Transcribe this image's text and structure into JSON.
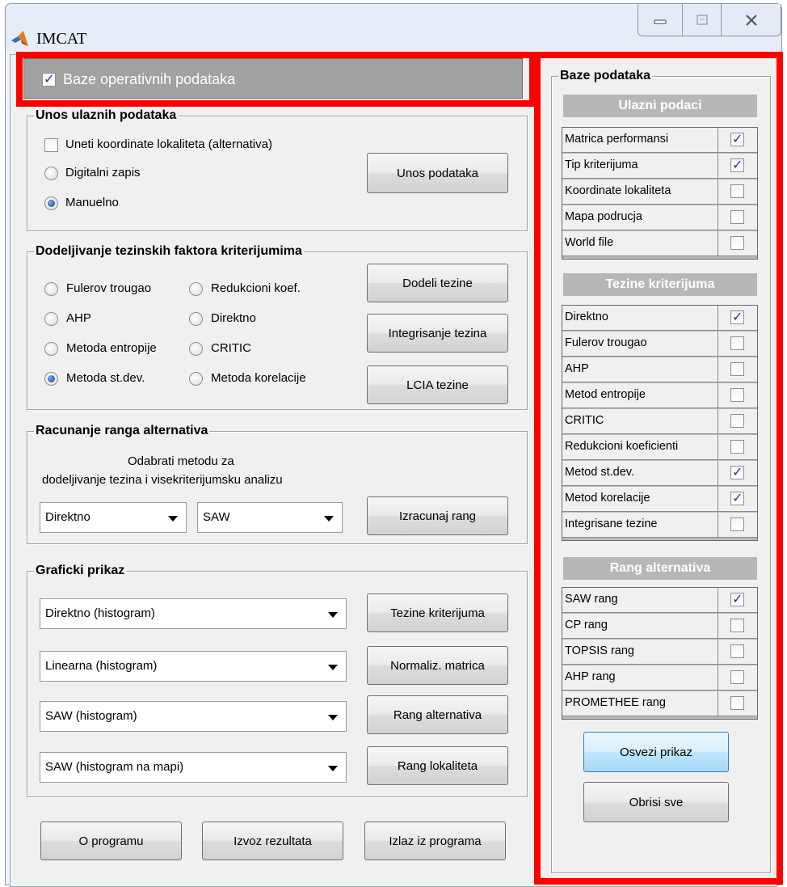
{
  "window": {
    "title": "IMCAT",
    "controls": [
      "minimize",
      "maximize",
      "close"
    ]
  },
  "top_checkbox": {
    "label": "Baze operativnih podataka",
    "checked": true
  },
  "unos": {
    "title": "Unos ulaznih podataka",
    "coords_label": "Uneti koordinate lokaliteta (alternativa)",
    "coords_checked": false,
    "digital_label": "Digitalni zapis",
    "manual_label": "Manuelno",
    "selected": "Manuelno",
    "button": "Unos podataka"
  },
  "dodeljivanje": {
    "title": "Dodeljivanje tezinskih faktora kriterijumima",
    "radios": [
      "Fulerov trougao",
      "Redukcioni koef.",
      "AHP",
      "Direktno",
      "Metoda entropije",
      "CRITIC",
      "Metoda st.dev.",
      "Metoda korelacije"
    ],
    "selected": "Metoda st.dev.",
    "buttons": [
      "Dodeli tezine",
      "Integrisanje tezina",
      "LCIA tezine"
    ]
  },
  "racunanje": {
    "title": "Racunanje ranga alternativa",
    "line1": "Odabrati metodu za",
    "line2": "dodeljivanje tezina i visekriterijumsku analizu",
    "select1": "Direktno",
    "select2": "SAW",
    "button": "Izracunaj rang"
  },
  "graficki": {
    "title": "Graficki prikaz",
    "rows": [
      {
        "select": "Direktno (histogram)",
        "button": "Tezine kriterijuma"
      },
      {
        "select": "Linearna (histogram)",
        "button": "Normaliz. matrica"
      },
      {
        "select": "SAW (histogram)",
        "button": "Rang alternativa"
      },
      {
        "select": "SAW (histogram na mapi)",
        "button": "Rang lokaliteta"
      }
    ]
  },
  "bottom_buttons": [
    "O programu",
    "Izvoz rezultata",
    "Izlaz iz programa"
  ],
  "baze": {
    "title": "Baze podataka",
    "sections": [
      {
        "header": "Ulazni podaci",
        "items": [
          {
            "label": "Matrica performansi",
            "checked": true
          },
          {
            "label": "Tip kriterijuma",
            "checked": true
          },
          {
            "label": "Koordinate lokaliteta",
            "checked": false
          },
          {
            "label": "Mapa podrucja",
            "checked": false
          },
          {
            "label": "World file",
            "checked": false
          }
        ]
      },
      {
        "header": "Tezine kriterijuma",
        "items": [
          {
            "label": "Direktno",
            "checked": true
          },
          {
            "label": "Fulerov trougao",
            "checked": false
          },
          {
            "label": "AHP",
            "checked": false
          },
          {
            "label": "Metod entropije",
            "checked": false
          },
          {
            "label": "CRITIC",
            "checked": false
          },
          {
            "label": "Redukcioni koeficienti",
            "checked": false
          },
          {
            "label": "Metod st.dev.",
            "checked": true
          },
          {
            "label": "Metod korelacije",
            "checked": true
          },
          {
            "label": "Integrisane tezine",
            "checked": false
          }
        ]
      },
      {
        "header": "Rang alternativa",
        "items": [
          {
            "label": "SAW rang",
            "checked": true
          },
          {
            "label": "CP rang",
            "checked": false
          },
          {
            "label": "TOPSIS rang",
            "checked": false
          },
          {
            "label": "AHP rang",
            "checked": false
          },
          {
            "label": "PROMETHEE rang",
            "checked": false
          }
        ]
      }
    ],
    "refresh_button": "Osvezi prikaz",
    "clear_button": "Obrisi sve"
  },
  "colors": {
    "highlight": "#ff0000",
    "section_header": "#b7b7b7",
    "top_bar": "#a2a2a2"
  }
}
